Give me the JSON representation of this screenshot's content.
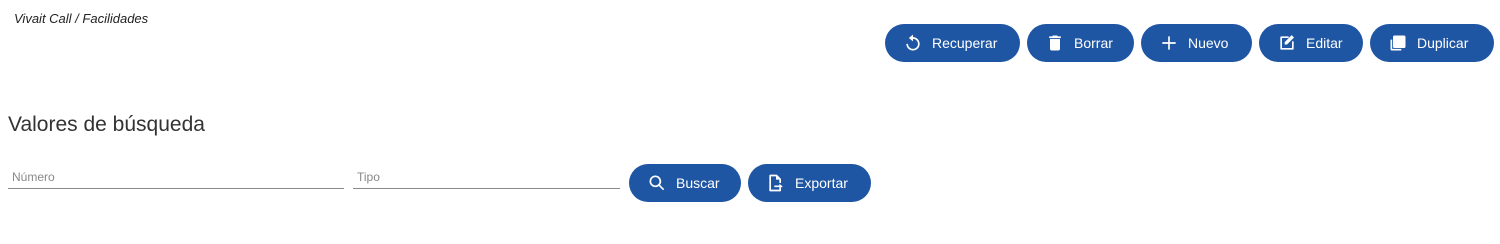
{
  "breadcrumb": "Vivait Call / Facilidades",
  "toolbar": {
    "recuperar": "Recuperar",
    "borrar": "Borrar",
    "nuevo": "Nuevo",
    "editar": "Editar",
    "duplicar": "Duplicar"
  },
  "search": {
    "title": "Valores de búsqueda",
    "numero_placeholder": "Número",
    "numero_value": "",
    "tipo_placeholder": "Tipo",
    "tipo_value": "",
    "buscar": "Buscar",
    "exportar": "Exportar"
  },
  "colors": {
    "button_bg": "#1f56a3",
    "button_text": "#ffffff"
  },
  "icons": {
    "recuperar": "undo-icon",
    "borrar": "trash-icon",
    "nuevo": "plus-icon",
    "editar": "edit-icon",
    "duplicar": "copy-icon",
    "buscar": "search-icon",
    "exportar": "export-icon"
  }
}
